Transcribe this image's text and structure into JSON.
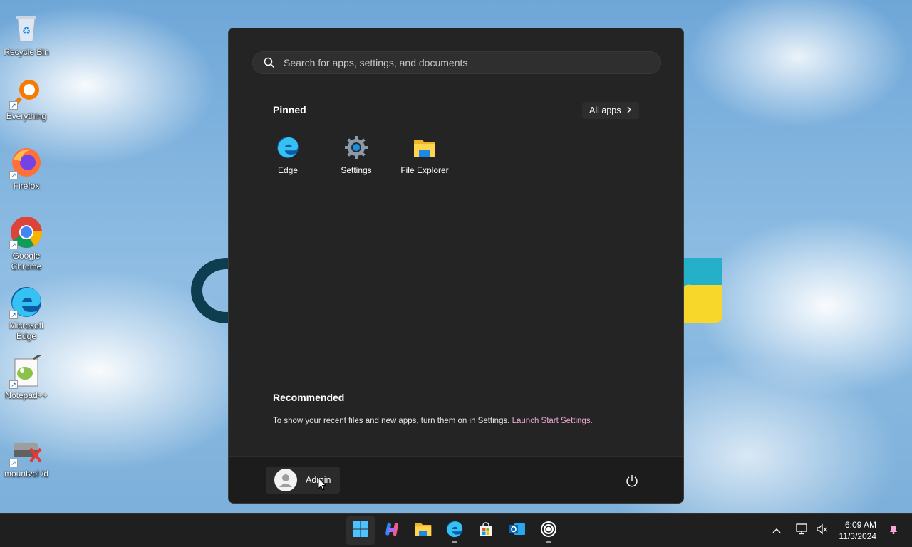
{
  "desktop": {
    "icons": [
      {
        "label": "Recycle Bin",
        "icon": "recycle-bin-icon"
      },
      {
        "label": "Everything",
        "icon": "everything-icon"
      },
      {
        "label": "Firefox",
        "icon": "firefox-icon"
      },
      {
        "label": "Google Chrome",
        "icon": "chrome-icon"
      },
      {
        "label": "Microsoft Edge",
        "icon": "edge-icon"
      },
      {
        "label": "Notepad++",
        "icon": "notepadpp-icon"
      },
      {
        "label": "mountvol /d",
        "icon": "mountvol-icon"
      }
    ]
  },
  "start_menu": {
    "search": {
      "placeholder": "Search for apps, settings, and documents",
      "value": ""
    },
    "pinned_title": "Pinned",
    "all_apps_label": "All apps",
    "pinned": [
      {
        "label": "Edge",
        "icon": "edge-icon"
      },
      {
        "label": "Settings",
        "icon": "settings-gear-icon"
      },
      {
        "label": "File Explorer",
        "icon": "folder-icon"
      }
    ],
    "recommended_title": "Recommended",
    "recommended_text": "To show your recent files and new apps, turn them on in Settings.",
    "recommended_link": "Launch Start Settings.",
    "user_name": "Admin"
  },
  "taskbar": {
    "apps": [
      {
        "name": "start",
        "icon": "windows-logo-icon",
        "active": true
      },
      {
        "name": "copilot",
        "icon": "copilot-icon"
      },
      {
        "name": "file-explorer",
        "icon": "folder-icon"
      },
      {
        "name": "edge",
        "icon": "edge-icon"
      },
      {
        "name": "store",
        "icon": "store-icon"
      },
      {
        "name": "outlook",
        "icon": "outlook-icon"
      },
      {
        "name": "app",
        "icon": "circle-app-icon"
      }
    ],
    "clock": {
      "time": "6:09 AM",
      "date": "11/3/2024"
    }
  },
  "colors": {
    "start_bg": "#242424",
    "taskbar_bg": "#1f1f1f",
    "link": "#e5a5d0",
    "accent": "#0078d4"
  }
}
